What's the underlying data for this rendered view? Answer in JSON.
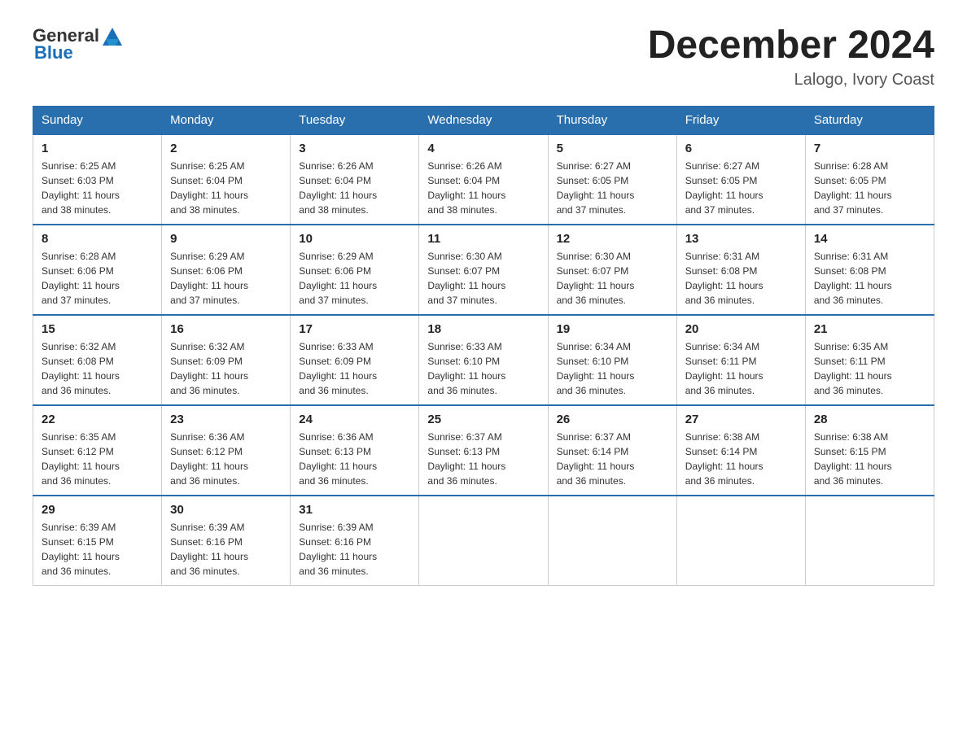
{
  "header": {
    "logo_general": "General",
    "logo_blue": "Blue",
    "month": "December 2024",
    "location": "Lalogo, Ivory Coast"
  },
  "weekdays": [
    "Sunday",
    "Monday",
    "Tuesday",
    "Wednesday",
    "Thursday",
    "Friday",
    "Saturday"
  ],
  "weeks": [
    [
      {
        "day": "1",
        "sunrise": "6:25 AM",
        "sunset": "6:03 PM",
        "daylight": "11 hours and 38 minutes."
      },
      {
        "day": "2",
        "sunrise": "6:25 AM",
        "sunset": "6:04 PM",
        "daylight": "11 hours and 38 minutes."
      },
      {
        "day": "3",
        "sunrise": "6:26 AM",
        "sunset": "6:04 PM",
        "daylight": "11 hours and 38 minutes."
      },
      {
        "day": "4",
        "sunrise": "6:26 AM",
        "sunset": "6:04 PM",
        "daylight": "11 hours and 38 minutes."
      },
      {
        "day": "5",
        "sunrise": "6:27 AM",
        "sunset": "6:05 PM",
        "daylight": "11 hours and 37 minutes."
      },
      {
        "day": "6",
        "sunrise": "6:27 AM",
        "sunset": "6:05 PM",
        "daylight": "11 hours and 37 minutes."
      },
      {
        "day": "7",
        "sunrise": "6:28 AM",
        "sunset": "6:05 PM",
        "daylight": "11 hours and 37 minutes."
      }
    ],
    [
      {
        "day": "8",
        "sunrise": "6:28 AM",
        "sunset": "6:06 PM",
        "daylight": "11 hours and 37 minutes."
      },
      {
        "day": "9",
        "sunrise": "6:29 AM",
        "sunset": "6:06 PM",
        "daylight": "11 hours and 37 minutes."
      },
      {
        "day": "10",
        "sunrise": "6:29 AM",
        "sunset": "6:06 PM",
        "daylight": "11 hours and 37 minutes."
      },
      {
        "day": "11",
        "sunrise": "6:30 AM",
        "sunset": "6:07 PM",
        "daylight": "11 hours and 37 minutes."
      },
      {
        "day": "12",
        "sunrise": "6:30 AM",
        "sunset": "6:07 PM",
        "daylight": "11 hours and 36 minutes."
      },
      {
        "day": "13",
        "sunrise": "6:31 AM",
        "sunset": "6:08 PM",
        "daylight": "11 hours and 36 minutes."
      },
      {
        "day": "14",
        "sunrise": "6:31 AM",
        "sunset": "6:08 PM",
        "daylight": "11 hours and 36 minutes."
      }
    ],
    [
      {
        "day": "15",
        "sunrise": "6:32 AM",
        "sunset": "6:08 PM",
        "daylight": "11 hours and 36 minutes."
      },
      {
        "day": "16",
        "sunrise": "6:32 AM",
        "sunset": "6:09 PM",
        "daylight": "11 hours and 36 minutes."
      },
      {
        "day": "17",
        "sunrise": "6:33 AM",
        "sunset": "6:09 PM",
        "daylight": "11 hours and 36 minutes."
      },
      {
        "day": "18",
        "sunrise": "6:33 AM",
        "sunset": "6:10 PM",
        "daylight": "11 hours and 36 minutes."
      },
      {
        "day": "19",
        "sunrise": "6:34 AM",
        "sunset": "6:10 PM",
        "daylight": "11 hours and 36 minutes."
      },
      {
        "day": "20",
        "sunrise": "6:34 AM",
        "sunset": "6:11 PM",
        "daylight": "11 hours and 36 minutes."
      },
      {
        "day": "21",
        "sunrise": "6:35 AM",
        "sunset": "6:11 PM",
        "daylight": "11 hours and 36 minutes."
      }
    ],
    [
      {
        "day": "22",
        "sunrise": "6:35 AM",
        "sunset": "6:12 PM",
        "daylight": "11 hours and 36 minutes."
      },
      {
        "day": "23",
        "sunrise": "6:36 AM",
        "sunset": "6:12 PM",
        "daylight": "11 hours and 36 minutes."
      },
      {
        "day": "24",
        "sunrise": "6:36 AM",
        "sunset": "6:13 PM",
        "daylight": "11 hours and 36 minutes."
      },
      {
        "day": "25",
        "sunrise": "6:37 AM",
        "sunset": "6:13 PM",
        "daylight": "11 hours and 36 minutes."
      },
      {
        "day": "26",
        "sunrise": "6:37 AM",
        "sunset": "6:14 PM",
        "daylight": "11 hours and 36 minutes."
      },
      {
        "day": "27",
        "sunrise": "6:38 AM",
        "sunset": "6:14 PM",
        "daylight": "11 hours and 36 minutes."
      },
      {
        "day": "28",
        "sunrise": "6:38 AM",
        "sunset": "6:15 PM",
        "daylight": "11 hours and 36 minutes."
      }
    ],
    [
      {
        "day": "29",
        "sunrise": "6:39 AM",
        "sunset": "6:15 PM",
        "daylight": "11 hours and 36 minutes."
      },
      {
        "day": "30",
        "sunrise": "6:39 AM",
        "sunset": "6:16 PM",
        "daylight": "11 hours and 36 minutes."
      },
      {
        "day": "31",
        "sunrise": "6:39 AM",
        "sunset": "6:16 PM",
        "daylight": "11 hours and 36 minutes."
      },
      null,
      null,
      null,
      null
    ]
  ],
  "labels": {
    "sunrise": "Sunrise:",
    "sunset": "Sunset:",
    "daylight": "Daylight:"
  }
}
